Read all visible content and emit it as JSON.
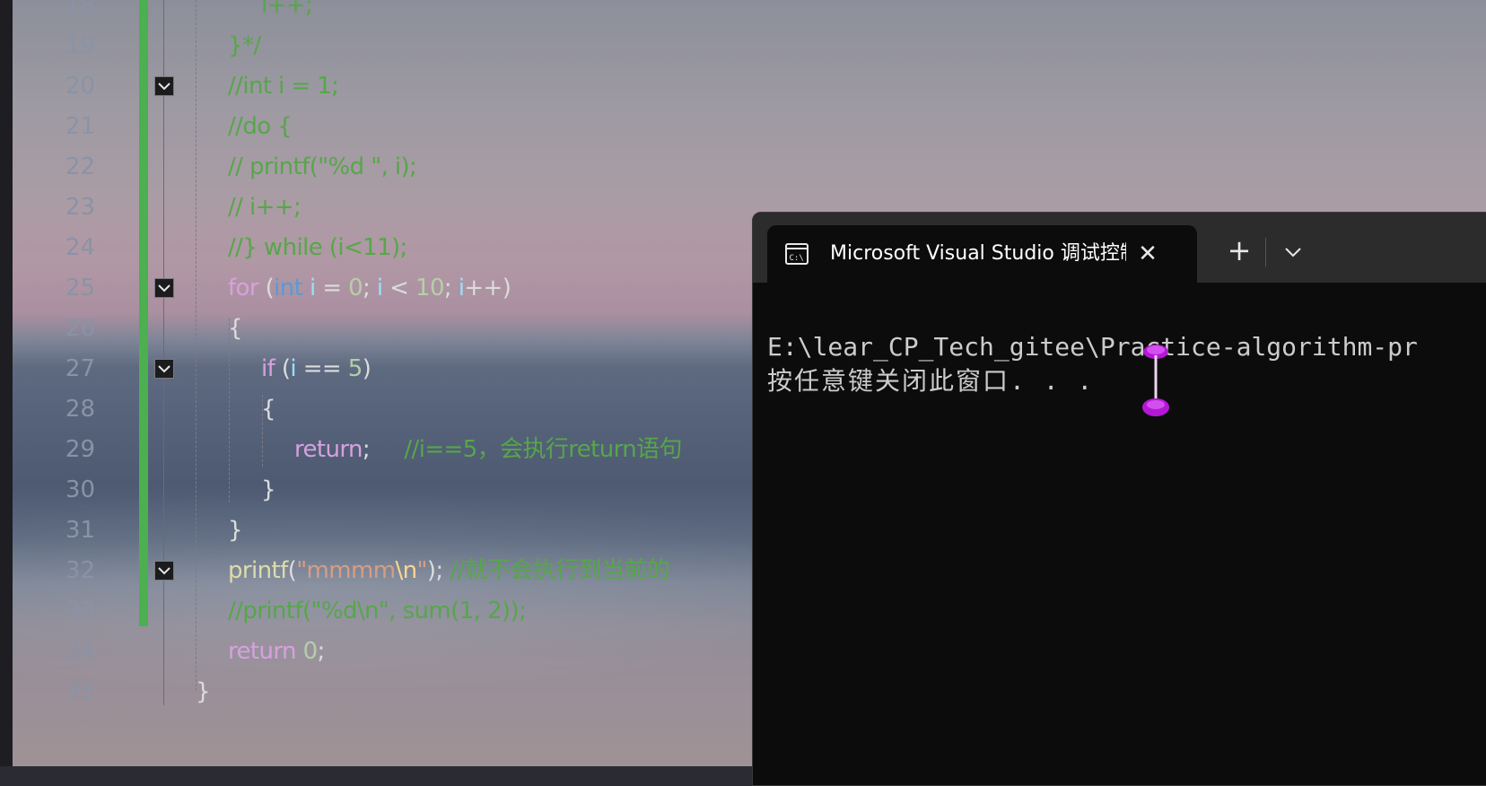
{
  "editor": {
    "lines": [
      {
        "n": "18",
        "indent": 2,
        "fold": false,
        "tokens": [
          {
            "t": "cm",
            "v": "i++;"
          }
        ]
      },
      {
        "n": "19",
        "indent": 1,
        "fold": false,
        "tokens": [
          {
            "t": "cm",
            "v": "}*/"
          }
        ]
      },
      {
        "n": "20",
        "indent": 1,
        "fold": true,
        "tokens": [
          {
            "t": "cm",
            "v": "//int i = 1;"
          }
        ]
      },
      {
        "n": "21",
        "indent": 1,
        "fold": false,
        "tokens": [
          {
            "t": "cm",
            "v": "//do {"
          }
        ]
      },
      {
        "n": "22",
        "indent": 1,
        "fold": false,
        "tokens": [
          {
            "t": "cm",
            "v": "// printf(\"%d \", i);"
          }
        ]
      },
      {
        "n": "23",
        "indent": 1,
        "fold": false,
        "tokens": [
          {
            "t": "cm",
            "v": "// i++;"
          }
        ]
      },
      {
        "n": "24",
        "indent": 1,
        "fold": false,
        "tokens": [
          {
            "t": "cm",
            "v": "//} while (i<11);"
          }
        ]
      },
      {
        "n": "25",
        "indent": 1,
        "fold": true,
        "tokens": [
          {
            "t": "kw",
            "v": "for"
          },
          {
            "t": "pu",
            "v": " ("
          },
          {
            "t": "ty",
            "v": "int"
          },
          {
            "t": "va",
            "v": " i"
          },
          {
            "t": "pu",
            "v": " = "
          },
          {
            "t": "nu",
            "v": "0"
          },
          {
            "t": "pu",
            "v": "; "
          },
          {
            "t": "va",
            "v": "i"
          },
          {
            "t": "pu",
            "v": " < "
          },
          {
            "t": "nu",
            "v": "10"
          },
          {
            "t": "pu",
            "v": "; "
          },
          {
            "t": "va",
            "v": "i"
          },
          {
            "t": "pu",
            "v": "++)"
          }
        ]
      },
      {
        "n": "26",
        "indent": 1,
        "fold": false,
        "tokens": [
          {
            "t": "pu",
            "v": "{"
          }
        ]
      },
      {
        "n": "27",
        "indent": 2,
        "fold": true,
        "tokens": [
          {
            "t": "kw",
            "v": "if"
          },
          {
            "t": "pu",
            "v": " ("
          },
          {
            "t": "va",
            "v": "i"
          },
          {
            "t": "pu",
            "v": " == "
          },
          {
            "t": "nu",
            "v": "5"
          },
          {
            "t": "pu",
            "v": ")"
          }
        ]
      },
      {
        "n": "28",
        "indent": 2,
        "fold": false,
        "tokens": [
          {
            "t": "pu",
            "v": "{"
          }
        ]
      },
      {
        "n": "29",
        "indent": 3,
        "fold": false,
        "tokens": [
          {
            "t": "kw",
            "v": "return"
          },
          {
            "t": "pu",
            "v": ";     "
          },
          {
            "t": "cm",
            "v": "//i==5，会执行return语句"
          }
        ]
      },
      {
        "n": "30",
        "indent": 2,
        "fold": false,
        "tokens": [
          {
            "t": "pu",
            "v": "}"
          }
        ]
      },
      {
        "n": "31",
        "indent": 1,
        "fold": false,
        "tokens": [
          {
            "t": "pu",
            "v": "}"
          }
        ]
      },
      {
        "n": "32",
        "indent": 1,
        "fold": true,
        "tokens": [
          {
            "t": "fn",
            "v": "printf"
          },
          {
            "t": "pu",
            "v": "("
          },
          {
            "t": "st",
            "v": "\"mmmm"
          },
          {
            "t": "es",
            "v": "\\n"
          },
          {
            "t": "st",
            "v": "\""
          },
          {
            "t": "pu",
            "v": "); "
          },
          {
            "t": "cm",
            "v": "//就不会执行到当前的"
          }
        ]
      },
      {
        "n": "33",
        "indent": 1,
        "fold": false,
        "tokens": [
          {
            "t": "cm",
            "v": "//printf(\"%d\\n\", sum(1, 2));"
          }
        ]
      },
      {
        "n": "34",
        "indent": 1,
        "fold": false,
        "tokens": [
          {
            "t": "kw",
            "v": "return"
          },
          {
            "t": "pu",
            "v": " "
          },
          {
            "t": "nu",
            "v": "0"
          },
          {
            "t": "pu",
            "v": ";"
          }
        ]
      },
      {
        "n": "35",
        "indent": 0,
        "fold": false,
        "tokens": [
          {
            "t": "pu",
            "v": "}"
          }
        ]
      }
    ]
  },
  "terminal": {
    "tab_title": "Microsoft Visual Studio 调试控制台",
    "tab_icon": "terminal-icon",
    "close_glyph": "✕",
    "new_tab_glyph": "+",
    "dropdown_icon": "chevron-down-icon",
    "output_lines": [
      "E:\\lear_CP_Tech_gitee\\Practice-algorithm-pr",
      "按任意键关闭此窗口. . ."
    ]
  },
  "colors": {
    "comment": "#57a64a",
    "keyword": "#d8a0df",
    "change_bar": "#4caf50",
    "cursor": "#b517d6"
  }
}
